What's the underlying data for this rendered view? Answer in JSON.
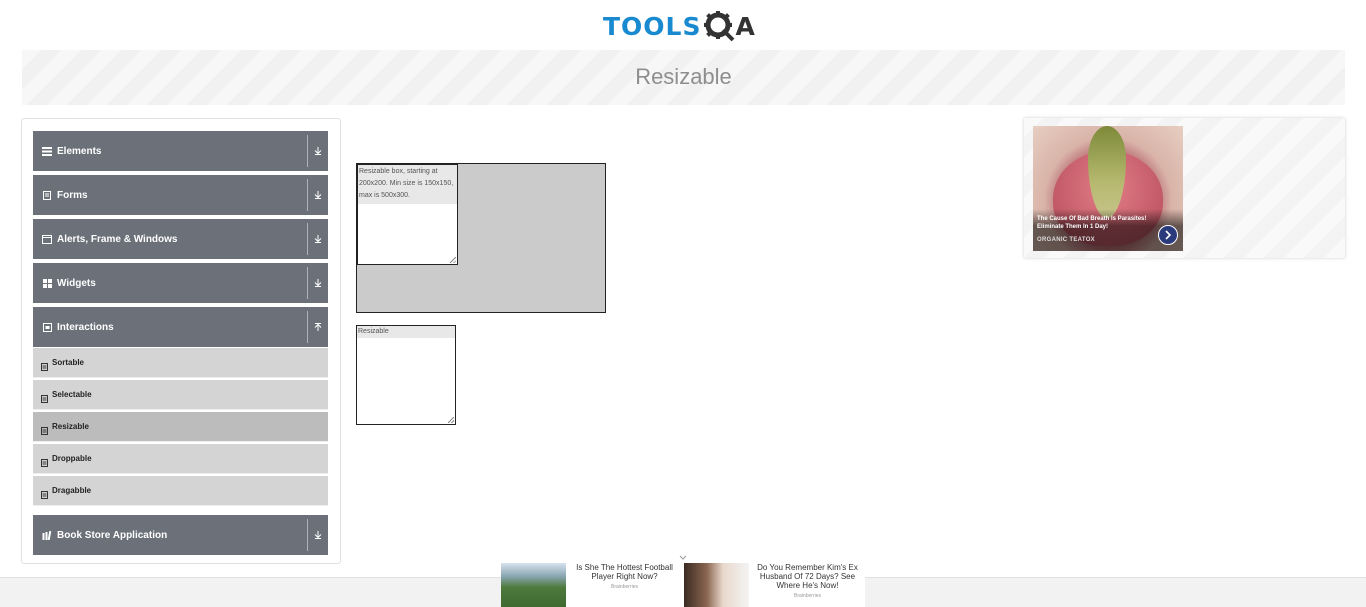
{
  "header": {
    "logo_text": "TOOLS",
    "logo_suffix": "A"
  },
  "banner": {
    "title": "Resizable"
  },
  "sidebar": {
    "groups": [
      {
        "label": "Elements",
        "icon": "hamburger-icon"
      },
      {
        "label": "Forms",
        "icon": "document-icon"
      },
      {
        "label": "Alerts, Frame & Windows",
        "icon": "window-icon"
      },
      {
        "label": "Widgets",
        "icon": "grid-icon"
      },
      {
        "label": "Interactions",
        "icon": "square-icon"
      },
      {
        "label": "Book Store Application",
        "icon": "books-icon"
      }
    ],
    "interactions_items": [
      {
        "label": "Sortable"
      },
      {
        "label": "Selectable"
      },
      {
        "label": "Resizable"
      },
      {
        "label": "Droppable"
      },
      {
        "label": "Dragabble"
      }
    ]
  },
  "main": {
    "box_restricted_text": "Resizable box, starting at 200x200. Min size is 150x150, max is 500x300.",
    "box_free_text": "Resizable"
  },
  "ad_right": {
    "caption": "The Cause Of Bad Breath Is Parasites! Eliminate Them In 1 Day!",
    "brand": "ORGANIC TEATOX"
  },
  "bottom_ads": [
    {
      "text": "Is She The Hottest Football Player Right Now?",
      "brand": "Brainberries"
    },
    {
      "text": "Do You Remember Kim's Ex Husband Of 72 Days? See Where He's Now!",
      "brand": "Brainberries"
    }
  ],
  "colors": {
    "accent": "#1a8ad0",
    "sidebar_header": "#6b7079",
    "sidebar_item": "#d4d4d4",
    "sidebar_item_active": "#bcbcbc"
  }
}
